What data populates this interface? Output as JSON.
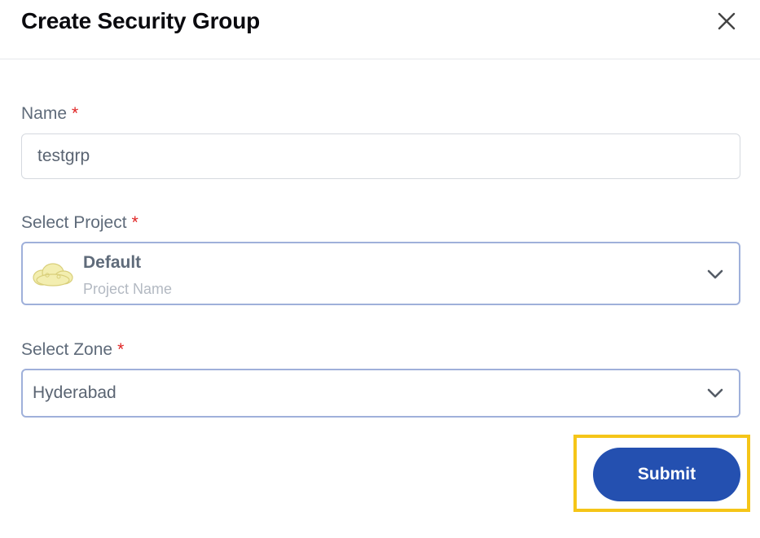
{
  "dialog": {
    "title": "Create Security Group",
    "close_icon": "close-icon"
  },
  "form": {
    "name": {
      "label": "Name",
      "required_mark": "*",
      "value": "testgrp"
    },
    "project": {
      "label": "Select Project",
      "required_mark": "*",
      "selected_name": "Default",
      "selected_subtext": "Project Name",
      "icon": "cloud-icon",
      "chevron_icon": "chevron-down-icon"
    },
    "zone": {
      "label": "Select Zone",
      "required_mark": "*",
      "selected": "Hyderabad",
      "chevron_icon": "chevron-down-icon"
    }
  },
  "actions": {
    "submit_label": "Submit"
  },
  "colors": {
    "primary": "#2450b0",
    "required": "#e02424",
    "highlight": "#f5c518",
    "select_border": "#9fb0da"
  }
}
